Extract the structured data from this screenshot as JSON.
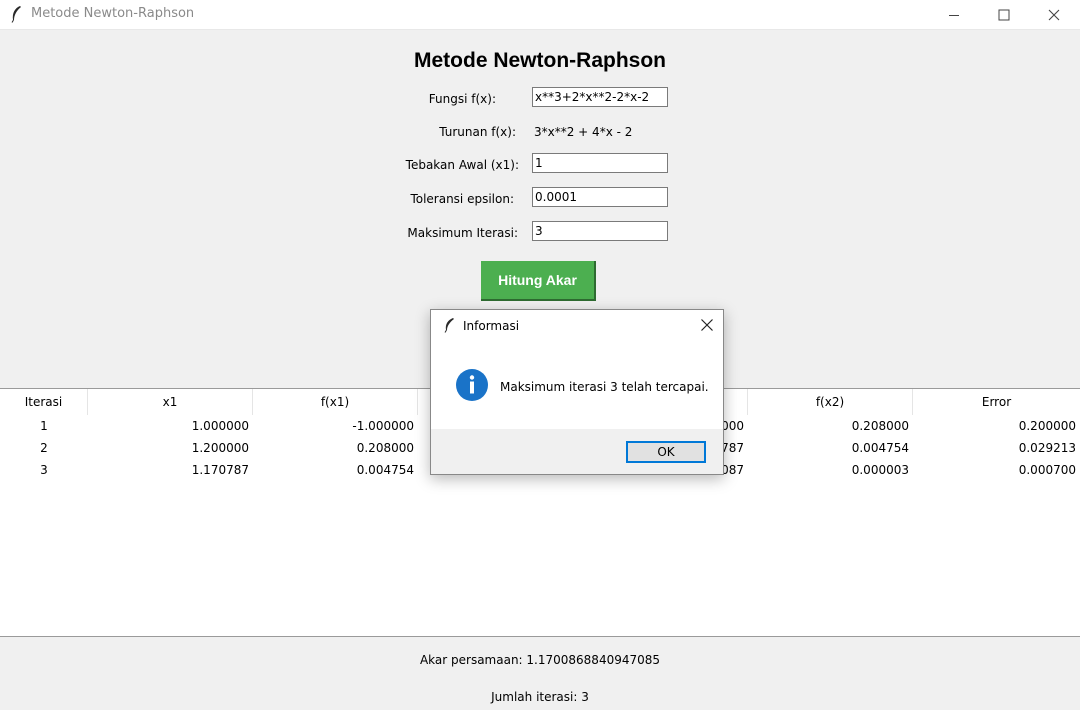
{
  "window": {
    "title": "Metode Newton-Raphson",
    "controls": [
      "minimize-icon",
      "maximize-icon",
      "close-icon"
    ]
  },
  "form": {
    "heading": "Metode Newton-Raphson",
    "function_label": "Fungsi f(x):",
    "function_value": "x**3+2*x**2-2*x-2",
    "derivative_label": "Turunan f(x):",
    "derivative_value": "3*x**2 + 4*x - 2",
    "initial_guess_label": "Tebakan Awal (x1):",
    "initial_guess_value": "1",
    "tolerance_label": "Toleransi epsilon:",
    "tolerance_value": "0.0001",
    "max_iter_label": "Maksimum Iterasi:",
    "max_iter_value": "3",
    "compute_button": "Hitung Akar"
  },
  "table": {
    "headers": [
      "Iterasi",
      "x1",
      "f(x1)",
      "",
      "",
      "f(x2)",
      "Error"
    ],
    "rows": [
      [
        "1",
        "1.000000",
        "-1.000000",
        "",
        "000",
        "0.208000",
        "0.200000"
      ],
      [
        "2",
        "1.200000",
        "0.208000",
        "",
        "787",
        "0.004754",
        "0.029213"
      ],
      [
        "3",
        "1.170787",
        "0.004754",
        "",
        "087",
        "0.000003",
        "0.000700"
      ]
    ]
  },
  "results": {
    "root": "Akar persamaan: 1.1700868840947085",
    "iterations": "Jumlah iterasi: 3"
  },
  "dialog": {
    "title": "Informasi",
    "message": "Maksimum iterasi 3 telah tercapai.",
    "ok_label": "OK",
    "icon": "info-icon",
    "accent": "#0078d7"
  },
  "colors": {
    "button_bg": "#4caf50",
    "window_bg": "#f0f0f0",
    "info_icon": "#1a73c8"
  }
}
